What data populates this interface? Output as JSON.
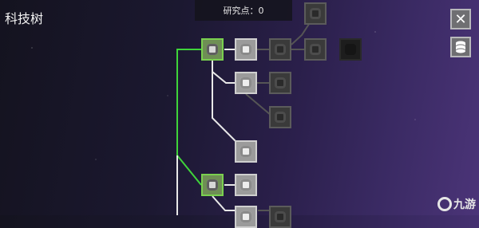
{
  "screen": {
    "title": "科技树",
    "research_points_label": "研究点：0"
  },
  "buttons": {
    "close_symbol": "✕",
    "database_icon": "database-icon"
  },
  "tech_tree": {
    "nodes": [
      {
        "id": "root",
        "state": "selected"
      },
      {
        "id": "a1",
        "state": "unlocked"
      },
      {
        "id": "a2",
        "state": "locked"
      },
      {
        "id": "a3",
        "state": "locked"
      },
      {
        "id": "a4",
        "state": "hidden"
      },
      {
        "id": "a5",
        "state": "locked"
      },
      {
        "id": "b1",
        "state": "unlocked"
      },
      {
        "id": "b2",
        "state": "locked"
      },
      {
        "id": "b3",
        "state": "locked"
      },
      {
        "id": "c1",
        "state": "unlocked"
      },
      {
        "id": "d1",
        "state": "selected"
      },
      {
        "id": "d2",
        "state": "unlocked"
      },
      {
        "id": "e1",
        "state": "unlocked"
      },
      {
        "id": "e2",
        "state": "locked"
      }
    ]
  },
  "colors": {
    "unlocked_link": "#e8e8e8",
    "active_link": "#3fd43a",
    "locked_link": "#555555"
  },
  "watermark": {
    "text": "九游"
  }
}
